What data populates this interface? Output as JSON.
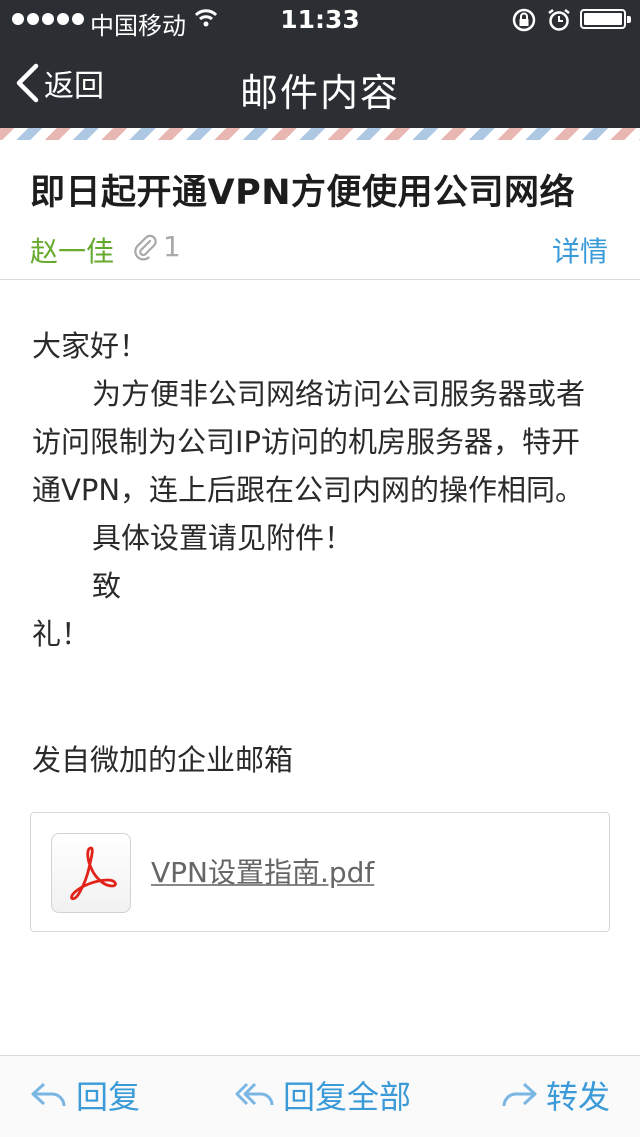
{
  "status_bar": {
    "carrier": "中国移动",
    "time": "11:33"
  },
  "nav": {
    "back_label": "返回",
    "title": "邮件内容"
  },
  "mail": {
    "subject": "即日起开通VPN方便使用公司网络",
    "sender": "赵一佳",
    "attachment_count": "1",
    "details_label": "详情",
    "body": {
      "greeting": "大家好！",
      "para1_line1": "为方便非公司网络访问公司服务器或者",
      "para1_line2": "访问限制为公司IP访问的机房服务器，特开",
      "para1_line3": "通VPN，连上后跟在公司内网的操作相同。",
      "para2": "具体设置请见附件！",
      "closing1": "致",
      "closing2": "礼！"
    },
    "signature": "发自微加的企业邮箱",
    "attachment": {
      "file_name": "VPN设置指南.pdf",
      "icon": "pdf-icon"
    }
  },
  "actions": {
    "reply": "回复",
    "reply_all": "回复全部",
    "forward": "转发"
  },
  "colors": {
    "nav_bg": "#2b2f33",
    "sender": "#67aa2e",
    "link": "#3b9ad8",
    "pdf_red": "#e2231a"
  }
}
